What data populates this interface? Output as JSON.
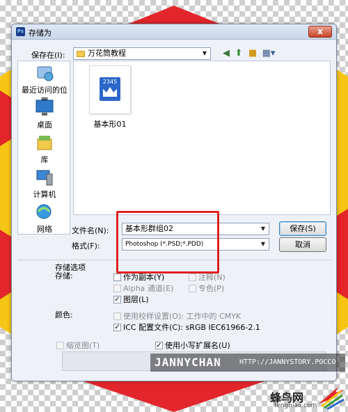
{
  "window": {
    "title": "存储为",
    "app_icon_text": "Ps",
    "close_label": "x"
  },
  "location": {
    "label": "保存在(I):",
    "value": "万花筒教程"
  },
  "places": [
    {
      "label": "最近访问的位置",
      "icon": "recent-places-icon"
    },
    {
      "label": "桌面",
      "icon": "desktop-icon"
    },
    {
      "label": "库",
      "icon": "libraries-icon"
    },
    {
      "label": "计算机",
      "icon": "computer-icon"
    },
    {
      "label": "网络",
      "icon": "network-icon"
    }
  ],
  "files": [
    {
      "name": "基本形01",
      "badge": "2345"
    }
  ],
  "form": {
    "filename_label": "文件名(N):",
    "filename_value": "基本形群组02",
    "format_label": "格式(F):",
    "format_value": "Photoshop (*.PSD;*.PDD)"
  },
  "buttons": {
    "save": "保存(S)",
    "cancel": "取消"
  },
  "options": {
    "section_title": "存储选项",
    "storage_label": "存储:",
    "as_copy": "作为副本(Y)",
    "alpha": "Alpha 通道(E)",
    "layers": "图层(L)",
    "notes": "注释(N)",
    "spot": "专色(P)",
    "color_label": "颜色:",
    "proof": "使用校样设置(O):",
    "proof_value": "工作中的 CMYK",
    "icc": "ICC 配置文件(C):",
    "icc_value": "sRGB IEC61966-2.1",
    "thumbnail": "缩览图(T)",
    "lowercase_ext": "使用小写扩展名(U)"
  },
  "watermark": {
    "name": "JANNYCHAN",
    "url": "HTTP://JANNYSTORY.POCCO"
  },
  "logo": {
    "text": "蜂鸟网",
    "sub": "fengniao.com"
  },
  "colors": {
    "accent_red": "#e02020",
    "dialog_bg": "#eef2f8",
    "decor_red": "#e2262b",
    "decor_yellow": "#f6c515"
  }
}
